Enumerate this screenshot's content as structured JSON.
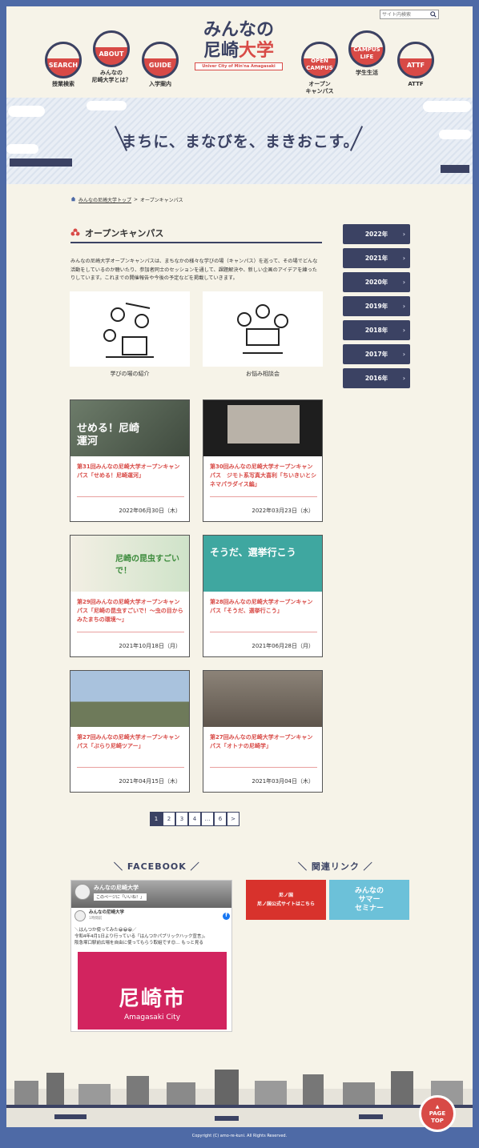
{
  "header": {
    "search_placeholder": "サイト内検索",
    "logo_line1": "みんなの",
    "logo_line2a": "尼崎",
    "logo_line2b": "大学",
    "logo_sub": "Univer City of Min'na Amagasaki",
    "nav": [
      {
        "badge": "SEARCH",
        "label": "授業検索"
      },
      {
        "badge": "ABOUT",
        "label": "みんなの\n尼崎大学とは？"
      },
      {
        "badge": "GUIDE",
        "label": "入学案内"
      },
      {
        "badge": "OPEN\nCAMPUS",
        "label": "オープン\nキャンパス"
      },
      {
        "badge": "CAMPUS\nLIFE",
        "label": "学生生活"
      },
      {
        "badge": "ATTF",
        "label": "ATTF"
      }
    ]
  },
  "hero": {
    "slogan": "まちに、まなびを、まきおこす。"
  },
  "breadcrumb": {
    "home": "みんなの尼崎大学トップ",
    "sep": ">",
    "current": "オープンキャンパス"
  },
  "section": {
    "title": "オープンキャンパス",
    "intro": "みんなの尼崎大学オープンキャンパスは、まちなかの様々な学びの場（キャンパス）を巡って、その場でどんな活動をしているのか聴いたり、参加者同士のセッションを通して、課題解決や、新しい企画のアイデアを練ったりしています。これまでの開催報告や今後の予定などを掲載していきます。",
    "illus": [
      {
        "caption": "学びの場の紹介"
      },
      {
        "caption": "お悩み相談会"
      }
    ]
  },
  "cards": [
    {
      "title": "第31回みんなの尼崎大学オープンキャンパス「せめる！尼崎運河」",
      "date": "2022年06月30日（木）",
      "photo_text": "せめる！尼崎運河",
      "color": "#5a6b5a"
    },
    {
      "title": "第30回みんなの尼崎大学オープンキャンパス　ジモト系写真大喜利「ちいきいとシネマパラダイス編」",
      "date": "2022年03月23日（水）",
      "photo_text": "",
      "color": "#2b2b2b"
    },
    {
      "title": "第29回みんなの尼崎大学オープンキャンパス「尼崎の昆虫すごいで！～虫の目からみたまちの環境～」",
      "date": "2021年10月18日（月）",
      "photo_text": "尼崎の昆虫すごいで！",
      "color": "#cfe3c9"
    },
    {
      "title": "第28回みんなの尼崎大学オープンキャンパス「そうだ、選挙行こう」",
      "date": "2021年06月28日（月）",
      "photo_text": "そうだ、選挙行こう",
      "color": "#3fa7a0"
    },
    {
      "title": "第27回みんなの尼崎大学オープンキャンパス「ぶらり尼崎ツアー」",
      "date": "2021年04月15日（木）",
      "photo_text": "",
      "color": "#8aa6c4"
    },
    {
      "title": "第27回みんなの尼崎大学オープンキャンパス「オトナの尼崎学」",
      "date": "2021年03月04日（木）",
      "photo_text": "",
      "color": "#7a6e62"
    }
  ],
  "years": [
    "2022年",
    "2021年",
    "2020年",
    "2019年",
    "2018年",
    "2017年",
    "2016年"
  ],
  "pagination": [
    "1",
    "2",
    "3",
    "4",
    "…",
    "6",
    ">"
  ],
  "facebook": {
    "heading": "FACEBOOK",
    "page_name": "みんなの尼崎大学",
    "like_btn": "このページに「いいね！」",
    "post_author": "みんなの尼崎大学",
    "post_time": "1時間前",
    "post_line1": "＼はんつか使ってみた😀😀😀／",
    "post_line2": "令和4年4月1日より行っている「はんつかパブリックハック宣言」。",
    "post_line3": "阪急塚口駅前広場を自由に使ってもらう取組です😊… もっと見る",
    "image_big": "尼崎市",
    "image_small": "Amagasaki City"
  },
  "links": {
    "heading": "関連リンク",
    "banners": [
      {
        "text": "尼ノ国\n尼ノ国公式サイトはこちら",
        "color": "#d8322c"
      },
      {
        "text": "みんなの\nサマー\nセミナー",
        "color": "#6cc1d9"
      }
    ]
  },
  "footer": {
    "copyright": "Copyright (C) amo-re-kuni. All Rights Reserved.",
    "pagetop": "PAGE\nTOP"
  }
}
